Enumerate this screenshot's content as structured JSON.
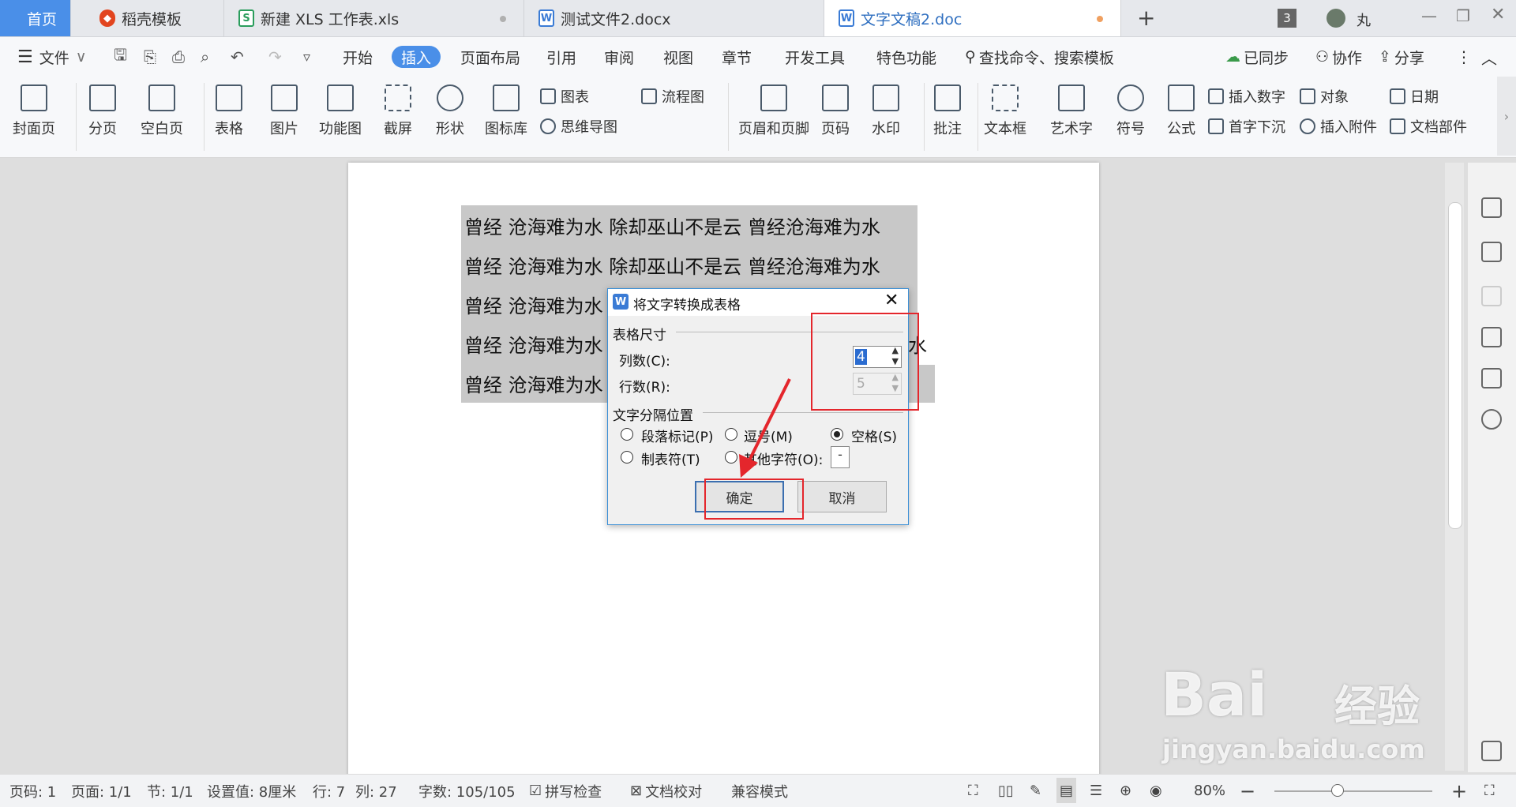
{
  "tabs": [
    {
      "label": "首页",
      "active": true
    },
    {
      "label": "稻壳模板",
      "icon": "daoke-icon"
    },
    {
      "label": "新建 XLS 工作表.xls",
      "icon": "spreadsheet-icon"
    },
    {
      "label": "测试文件2.docx",
      "icon": "writer-icon"
    },
    {
      "label": "文字文稿2.doc",
      "icon": "writer-icon",
      "current": true
    }
  ],
  "window": {
    "badge_count": "3",
    "user_name": "丸"
  },
  "menu": {
    "file": "文件",
    "items": [
      "开始",
      "插入",
      "页面布局",
      "引用",
      "审阅",
      "视图",
      "章节",
      "开发工具",
      "特色功能"
    ],
    "active": "插入",
    "search": "查找命令、搜索模板",
    "sync": "已同步",
    "collab": "协作",
    "share": "分享"
  },
  "ribbon": {
    "cover": "封面页",
    "pagebreak": "分页",
    "blank": "空白页",
    "table": "表格",
    "picture": "图片",
    "function": "功能图",
    "screenshot": "截屏",
    "shape": "形状",
    "iconlib": "图标库",
    "chart": "图表",
    "mindmap": "思维导图",
    "flowchart": "流程图",
    "header_footer": "页眉和页脚",
    "pagenum": "页码",
    "watermark": "水印",
    "comment": "批注",
    "textbox": "文本框",
    "wordart": "艺术字",
    "symbol": "符号",
    "formula": "公式",
    "insert_number": "插入数字",
    "dropcap": "首字下沉",
    "object": "对象",
    "attach": "插入附件",
    "date": "日期",
    "docpart": "文档部件"
  },
  "document": {
    "lines": [
      "曾经 沧海难为水 除却巫山不是云 曾经沧海难为水",
      "曾经 沧海难为水 除却巫山不是云 曾经沧海难为水",
      "曾经 沧海难为水",
      "曾经 沧海难为水",
      "曾经 沧海难为水"
    ],
    "tail": "水"
  },
  "dialog": {
    "title": "将文字转换成表格",
    "section_size": "表格尺寸",
    "cols_label": "列数(C):",
    "cols_value": "4",
    "rows_label": "行数(R):",
    "rows_value": "5",
    "section_sep": "文字分隔位置",
    "opt_para": "段落标记(P)",
    "opt_comma": "逗号(M)",
    "opt_space": "空格(S)",
    "opt_tab": "制表符(T)",
    "opt_other": "其他字符(O):",
    "other_value": "-",
    "selected": "空格(S)",
    "ok": "确定",
    "cancel": "取消"
  },
  "status": {
    "page": "页码: 1",
    "pages": "页面: 1/1",
    "section": "节: 1/1",
    "setting": "设置值: 8厘米",
    "row": "行: 7",
    "col": "列: 27",
    "words": "字数: 105/105",
    "spell": "拼写检查",
    "proof": "文档校对",
    "compat": "兼容模式",
    "zoom": "80%"
  },
  "watermark": {
    "brand": "Bai",
    "brand2": "经验",
    "url": "jingyan.baidu.com"
  },
  "colors": {
    "accent": "#4a8fe8",
    "highlight_red": "#e4262c"
  }
}
